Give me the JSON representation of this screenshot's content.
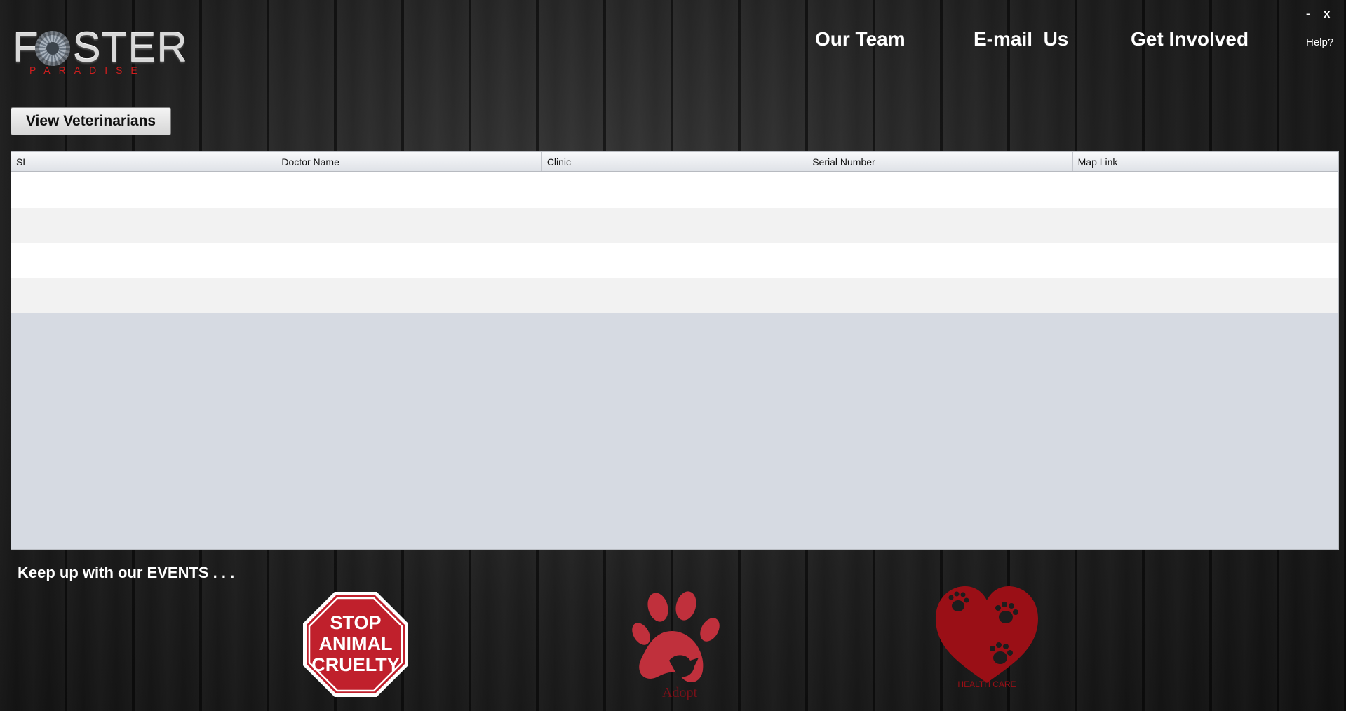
{
  "brand": {
    "name": "FOSTER",
    "name_left": "F",
    "name_right": "STER",
    "tagline": "PARADISE"
  },
  "window": {
    "minimize": "-",
    "close": "x"
  },
  "nav": [
    {
      "label": "Our Team"
    },
    {
      "label": "E-mail  Us"
    },
    {
      "label": "Get Involved"
    }
  ],
  "help": "Help?",
  "actions": {
    "view_vets": "View Veterinarians"
  },
  "table": {
    "columns": [
      "SL",
      "Doctor Name",
      "Clinic",
      "Serial Number",
      "Map Link"
    ],
    "rows": [
      [
        "",
        "",
        "",
        "",
        ""
      ],
      [
        "",
        "",
        "",
        "",
        ""
      ],
      [
        "",
        "",
        "",
        "",
        ""
      ],
      [
        "",
        "",
        "",
        "",
        ""
      ]
    ]
  },
  "events": {
    "heading": "Keep up with our EVENTS . . .",
    "items": [
      {
        "name": "stop-animal-cruelty",
        "lines": [
          "STOP",
          "ANIMAL",
          "CRUELTY"
        ],
        "icon": "stop-sign-icon"
      },
      {
        "name": "adopt",
        "label": "Adopt",
        "icon": "paw-icon"
      },
      {
        "name": "health-care",
        "label": "HEALTH CARE",
        "icon": "heart-paws-icon"
      }
    ]
  },
  "colors": {
    "accent_red": "#c0303c",
    "dark_red": "#9a0f16",
    "logo_red": "#d01e1e"
  }
}
